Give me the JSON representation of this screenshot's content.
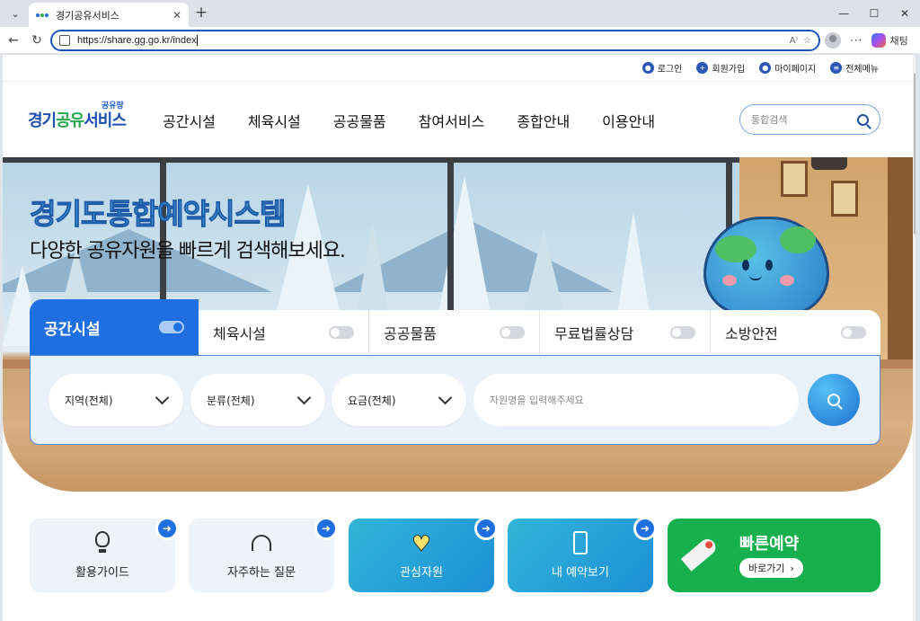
{
  "browser": {
    "tab_title": "경기공유서비스",
    "url": "https://share.gg.go.kr/index",
    "copilot_label": "채팅"
  },
  "util_links": [
    {
      "label": "로그인",
      "icon": "lock-icon"
    },
    {
      "label": "회원가입",
      "icon": "user-plus-icon"
    },
    {
      "label": "마이페이지",
      "icon": "user-icon"
    },
    {
      "label": "전체메뉴",
      "icon": "menu-icon"
    }
  ],
  "logo": {
    "small": "공유랑",
    "main_a": "경기",
    "main_b": "공유",
    "main_c": "서비스"
  },
  "gnb": [
    "공간시설",
    "체육시설",
    "공공물품",
    "참여서비스",
    "종합안내",
    "이용안내"
  ],
  "top_search": {
    "placeholder": "통합검색"
  },
  "hero": {
    "title": "경기도통합예약시스템",
    "subtitle": "다양한 공유자원을 빠르게 검색해보세요."
  },
  "widget": {
    "tabs": [
      {
        "label": "공간시설",
        "active": true
      },
      {
        "label": "체육시설",
        "active": false
      },
      {
        "label": "공공물품",
        "active": false
      },
      {
        "label": "무료법률상담",
        "active": false
      },
      {
        "label": "소방안전",
        "active": false
      }
    ],
    "selects": [
      "지역(전체)",
      "분류(전체)",
      "요금(전체)"
    ],
    "keyword_placeholder": "자원명을 입력해주세요"
  },
  "quick": [
    {
      "label": "활용가이드",
      "icon": "lightbulb-icon"
    },
    {
      "label": "자주하는 질문",
      "icon": "headset-icon"
    },
    {
      "label": "관심자원",
      "icon": "heart-icon"
    },
    {
      "label": "내 예약보기",
      "icon": "phone-icon"
    }
  ],
  "fast_reserve": {
    "title": "빠른예약",
    "button": "바로가기",
    "icon": "rocket-icon"
  },
  "colors": {
    "brand_blue": "#1f6fe0",
    "brand_green": "#17b04e",
    "teal": "#32b6d8"
  }
}
